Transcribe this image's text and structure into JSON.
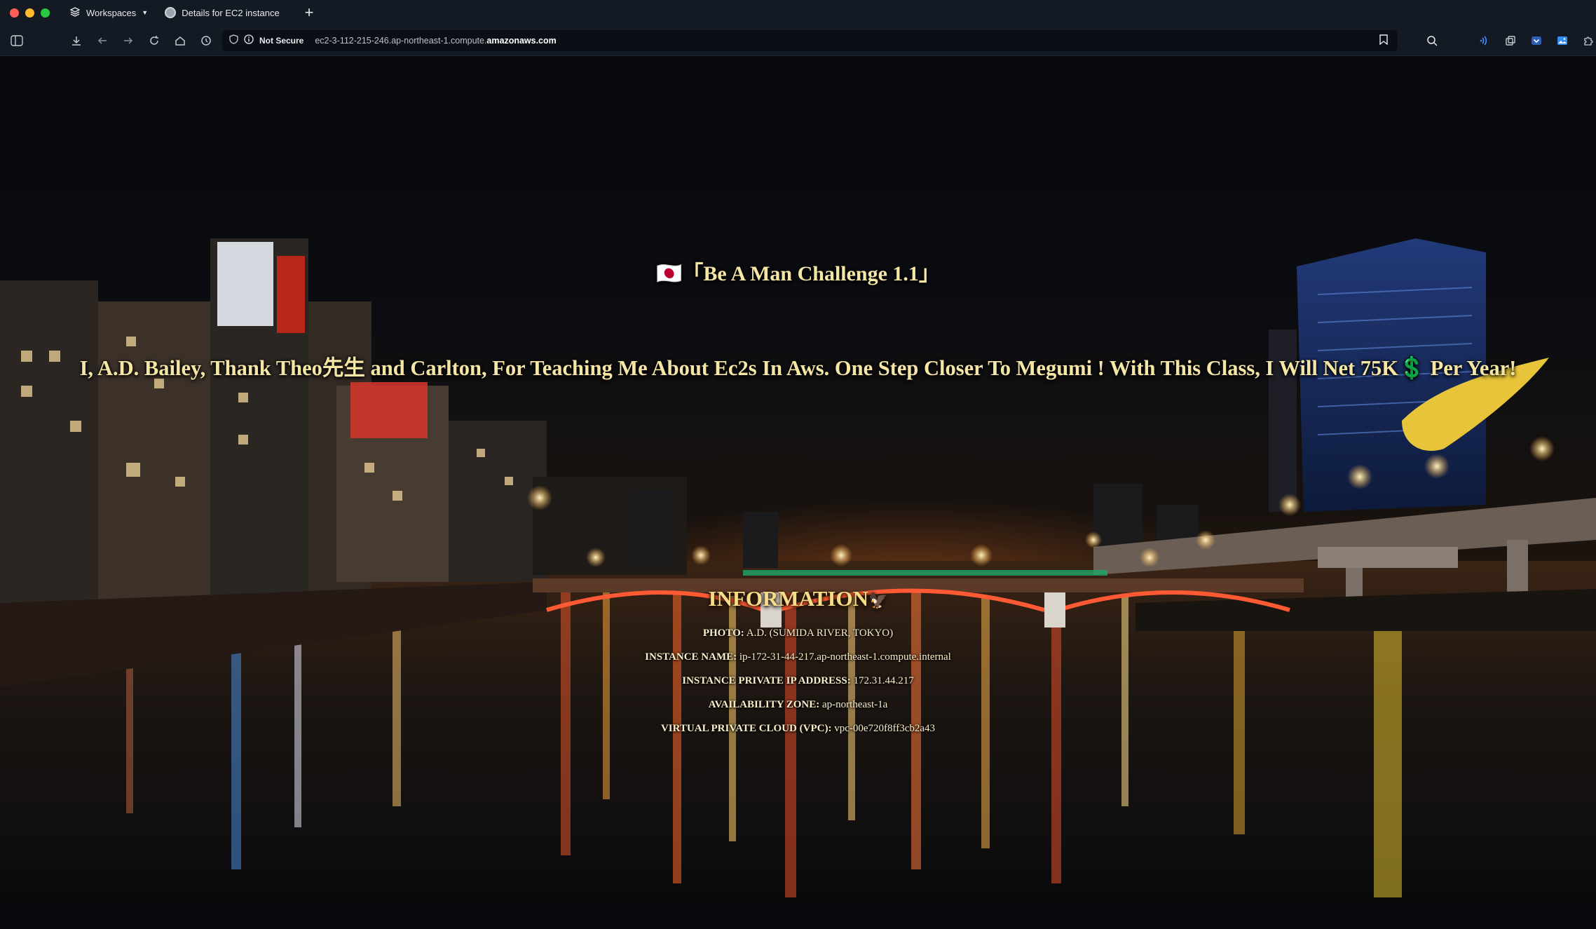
{
  "browser": {
    "workspaces_label": "Workspaces",
    "tab_title": "Details for EC2 instance",
    "new_tab_symbol": "+",
    "security_label": "Not Secure",
    "url_prefix": "ec2-3-112-215-246.ap-northeast-1.compute.",
    "url_domain": "amazonaws.com"
  },
  "page": {
    "flag": "🇯🇵",
    "challenge_title": "「Be A Man Challenge 1.1」",
    "thanks_line": "I, A.D. Bailey, Thank Theo先生 and Carlton, For Teaching Me About Ec2s In Aws. One Step Closer To Megumi ! With This Class, I Will Net 75K💲 Per Year!",
    "info_heading": "INFORMATION",
    "info_heading_emoji": "🦅",
    "info": [
      {
        "label": "PHOTO:",
        "value": "A.D. (SUMIDA RIVER, TOKYO)"
      },
      {
        "label": "INSTANCE NAME:",
        "value": "ip-172-31-44-217.ap-northeast-1.compute.internal"
      },
      {
        "label": "INSTANCE PRIVATE IP ADDRESS:",
        "value": "172.31.44.217"
      },
      {
        "label": "AVAILABILITY ZONE:",
        "value": "ap-northeast-1a"
      },
      {
        "label": "VIRTUAL PRIVATE CLOUD (VPC):",
        "value": "vpc-00e720f8ff3cb2a43"
      }
    ]
  }
}
